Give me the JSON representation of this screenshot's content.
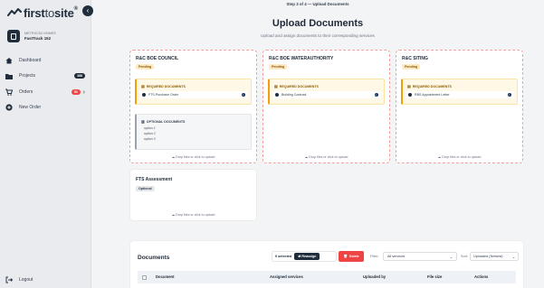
{
  "brand": {
    "name_first": "first",
    "name_to": "to",
    "name_site": "site",
    "reg": "®"
  },
  "org": {
    "subtitle": "METRICON HOMES",
    "name": "FastTrack 152"
  },
  "nav": {
    "dashboard": "Dashboard",
    "projects": "Projects",
    "projects_count": "388",
    "orders": "Orders",
    "orders_count": "53",
    "new_order": "New Order",
    "logout": "Logout"
  },
  "header": {
    "step": "Step 3 of 4 — Upload Documents",
    "title": "Upload Documents",
    "subtitle": "Upload and assign documents to their corresponding services"
  },
  "labels": {
    "required_documents": "REQUIRED DOCUMENTS",
    "optional_documents": "OPTIONAL DOCUMENTS",
    "drop_hint": "Drop files or click to upload"
  },
  "cards": [
    {
      "title": "R&C BOE COUNCIL",
      "status": "Pending",
      "required": "FTS Purchase Order",
      "optional": [
        "option 1",
        "option 2",
        "option 3"
      ]
    },
    {
      "title": "R&C BOE WATERAUTHORITY",
      "status": "Pending",
      "required": "Building Contract"
    },
    {
      "title": "R&C SITING",
      "status": "Pending",
      "required": "RBS Appointment Letter"
    },
    {
      "title": "FTS Assessment",
      "status": "Optional"
    }
  ],
  "documents": {
    "title": "Documents",
    "selected": "0 selected",
    "reassign": "Reassign",
    "delete": "Delete",
    "filter_label": "Filter:",
    "filter_value": "All services",
    "sort_label": "Sort:",
    "sort_value": "Uploaded (Newest)",
    "columns": [
      "Document",
      "Assigned services",
      "Uploaded by",
      "File size",
      "Actions"
    ]
  },
  "colors": {
    "accent": "#1f2d3d",
    "danger": "#ef4444",
    "pending": "#fde9c4",
    "dashed_border": "#f2a0a0"
  }
}
